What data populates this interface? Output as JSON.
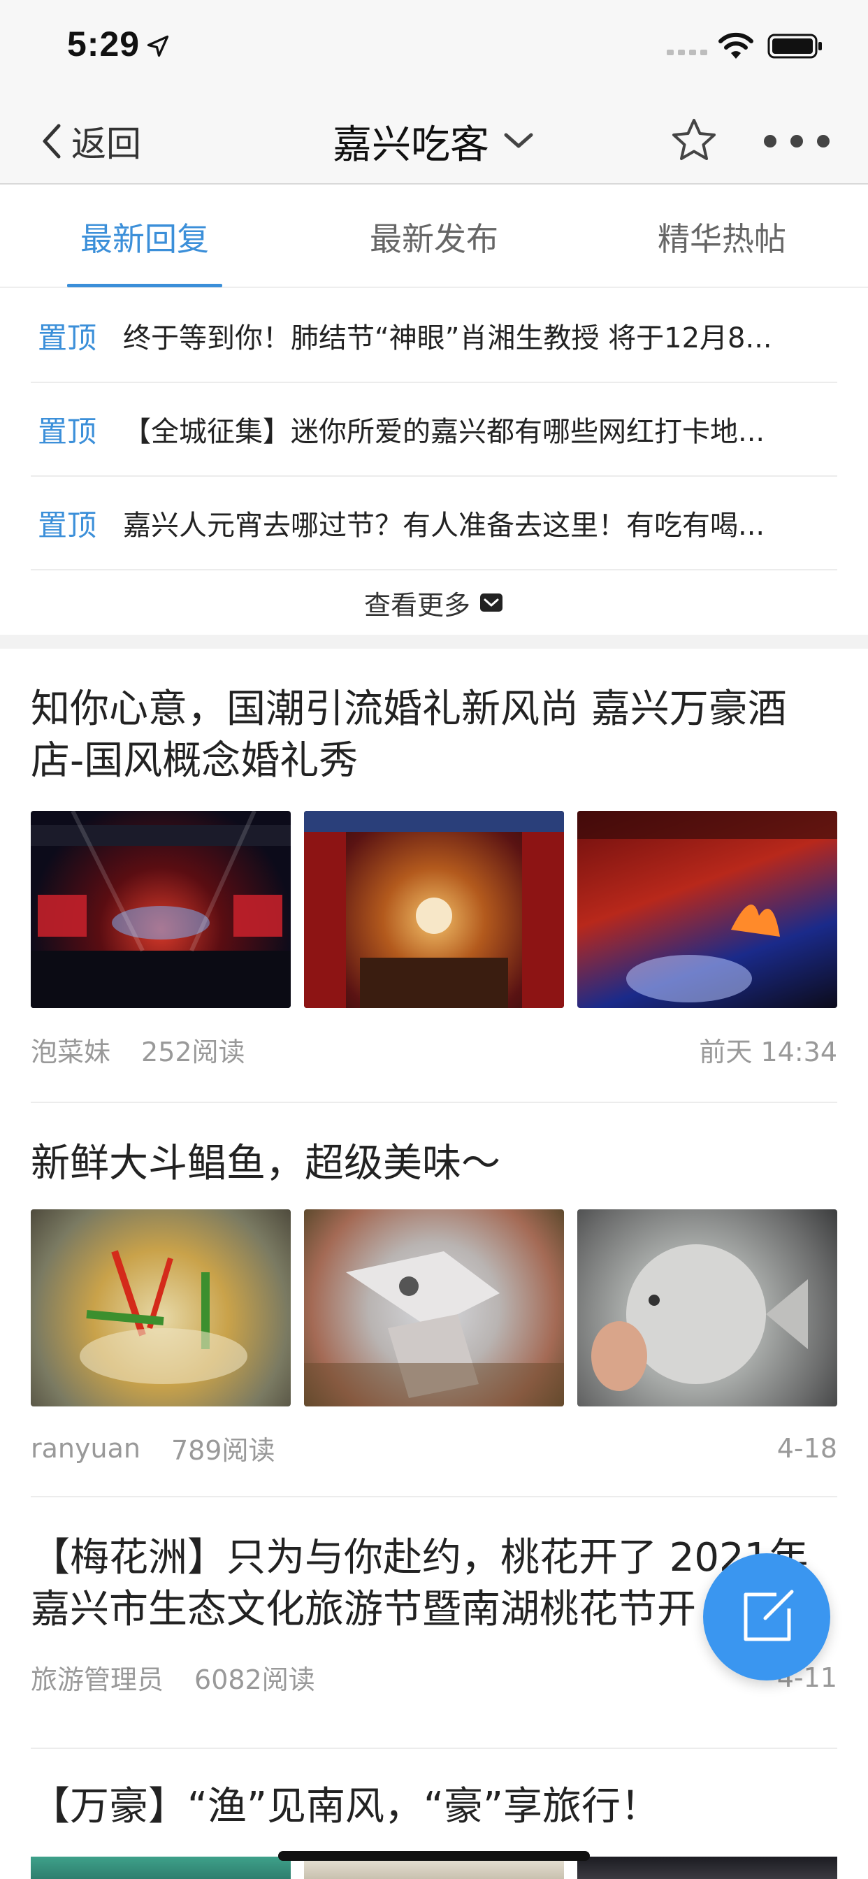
{
  "status_bar": {
    "time": "5:29"
  },
  "nav": {
    "back_label": "返回",
    "title": "嘉兴吃客"
  },
  "tabs": [
    {
      "label": "最新回复",
      "active": true
    },
    {
      "label": "最新发布",
      "active": false
    },
    {
      "label": "精华热帖",
      "active": false
    }
  ],
  "pinned": {
    "items": [
      {
        "tag": "置顶",
        "title": "终于等到你！肺结节“神眼”肖湘生教授 将于12月8..."
      },
      {
        "tag": "置顶",
        "title": "【全城征集】迷你所爱的嘉兴都有哪些网红打卡地..."
      },
      {
        "tag": "置顶",
        "title": "嘉兴人元宵去哪过节？有人准备去这里！有吃有喝..."
      }
    ],
    "see_more": "查看更多"
  },
  "posts": [
    {
      "title": "知你心意，国潮引流婚礼新风尚 嘉兴万豪酒店-国风概念婚礼秀",
      "author": "泡菜妹",
      "reads": "252阅读",
      "date": "前天 14:34"
    },
    {
      "title": "新鲜大斗鲳鱼，超级美味～",
      "author": "ranyuan",
      "reads": "789阅读",
      "date": "4-18"
    },
    {
      "title": "【梅花洲】只为与你赴约，桃花开了 2021年嘉兴市生态文化旅游节暨南湖桃花节开",
      "author": "旅游管理员",
      "reads": "6082阅读",
      "date": "4-11"
    },
    {
      "title": "【万豪】“渔”见南风，“豪”享旅行！"
    }
  ],
  "colors": {
    "accent": "#3b8fd9",
    "fab": "#3a96f0",
    "meta_text": "#999999"
  },
  "icons": [
    "location-arrow-icon",
    "signal-icon",
    "wifi-icon",
    "battery-icon",
    "back-chevron-icon",
    "chevron-down-icon",
    "star-icon",
    "more-dots-icon",
    "mail-icon",
    "compose-icon"
  ]
}
